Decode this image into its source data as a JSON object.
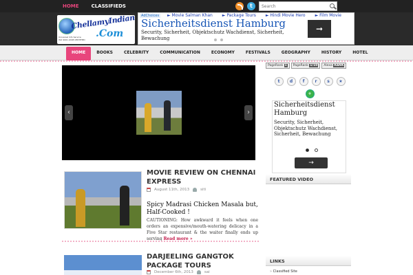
{
  "topnav": {
    "items": [
      {
        "label": "HOME",
        "active": true
      },
      {
        "label": "CLASSIFIEDS",
        "active": false
      }
    ],
    "search_placeholder": "Search"
  },
  "logo": {
    "name": "ChellamyIndians",
    "suffix": ".Com",
    "tagline_1": "Universal Info Service",
    "tagline_2": "ISO 9001:2008 CERTIFIED"
  },
  "ad_banner": {
    "choices_label": "AdChoices",
    "links": [
      "Movie Salman Khan",
      "Package Tours",
      "Hindi Movie Hero",
      "Film Movie"
    ],
    "title": "Sicherheitsdienst Hamburg",
    "description": "Security, Sicherheit, Objektschutz Wachdienst, Sicherheit, Bewachung"
  },
  "mainnav": {
    "items": [
      {
        "label": "HOME",
        "active": true
      },
      {
        "label": "BOOKS",
        "active": false
      },
      {
        "label": "CELEBRITY",
        "active": false
      },
      {
        "label": "COMMUNICATION",
        "active": false
      },
      {
        "label": "ECONOMY",
        "active": false
      },
      {
        "label": "FESTIVALS",
        "active": false
      },
      {
        "label": "GEOGRAPHY",
        "active": false
      },
      {
        "label": "HISTORY",
        "active": false
      },
      {
        "label": "HOTEL",
        "active": false
      }
    ]
  },
  "slider": {
    "prev": "‹",
    "next": "›"
  },
  "posts": [
    {
      "title": "MOVIE REVIEW ON CHENNAI EXPRESS",
      "date": "August 11th, 2013",
      "author": "siti",
      "subtitle": "Spicy Madrasi Chicken Masala but, Half-Cooked !",
      "excerpt": "CAUTIONING: How awkward it feels when one orders an expensive/mouth-watering delicacy in a Five Star restaurant & the waiter finally ends up serving",
      "read_more": "Read more »"
    },
    {
      "title": "DARJEELING GANGTOK PACKAGE TOURS",
      "date": "December 6th, 2013",
      "author": "sai"
    }
  ],
  "sidebar": {
    "pagerank": [
      {
        "label": "PageRank",
        "value": "1"
      },
      {
        "label": "PageRank",
        "value": "1/10"
      },
      {
        "label": "Alexa",
        "value": "RANK"
      }
    ],
    "social_icons": [
      "t",
      "d",
      "f",
      "r",
      "s",
      "★",
      "+"
    ],
    "ad": {
      "title": "Sicherheitsdienst Hamburg",
      "description": "Security, Sicherheit, Objektschutz Wachdienst, Sicherheit, Bewachung",
      "button": "→"
    },
    "featured_heading": "FEATURED VIDEO",
    "links_heading": "LINKS",
    "links": [
      "Classified Site"
    ]
  }
}
